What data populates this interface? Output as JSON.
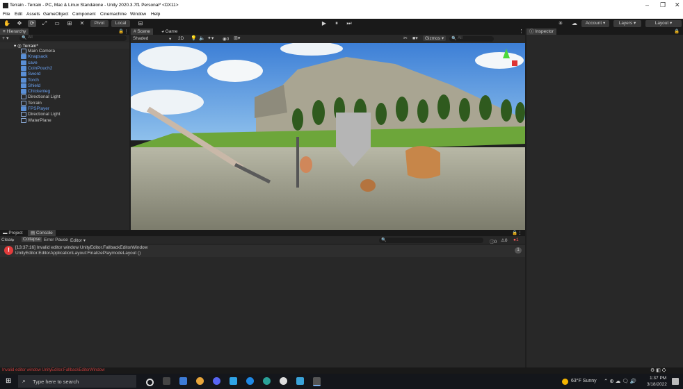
{
  "window": {
    "title": "Terrain - Terrain - PC, Mac & Linux Standalone - Unity 2020.3.7f1 Personal* <DX11>",
    "controls": [
      "–",
      "❐",
      "✕"
    ]
  },
  "menu": [
    "File",
    "Edit",
    "Assets",
    "GameObject",
    "Component",
    "Cinemachine",
    "Window",
    "Help"
  ],
  "toolbar": {
    "pivot_label": "Pivot",
    "local_label": "Local",
    "account_label": "Account ▾",
    "layers_label": "Layers ▾",
    "layout_label": "Layout ▾"
  },
  "hierarchy": {
    "tab_label": "Hierarchy",
    "search_placeholder": "All",
    "add_label": "+ ▾",
    "scene_label": "Terrain*",
    "items": [
      {
        "label": "Main Camera",
        "prefab": false
      },
      {
        "label": "Knapsack",
        "prefab": true
      },
      {
        "label": "cave",
        "prefab": true
      },
      {
        "label": "CoinPouch2",
        "prefab": true
      },
      {
        "label": "Sword",
        "prefab": true
      },
      {
        "label": "Torch",
        "prefab": true
      },
      {
        "label": "Shield",
        "prefab": true
      },
      {
        "label": "Chickenleg",
        "prefab": true
      },
      {
        "label": "Directional Light",
        "prefab": false
      },
      {
        "label": "Terrain",
        "prefab": false
      },
      {
        "label": "FPSPlayer",
        "prefab": true
      },
      {
        "label": "Directional Light",
        "prefab": false
      },
      {
        "label": "WaterPlane",
        "prefab": false
      }
    ]
  },
  "scene": {
    "tab_scene": "Scene",
    "tab_game": "Game",
    "shading": "Shaded",
    "mode_2d": "2D",
    "gizmos": "Gizmos ▾",
    "search_placeholder": "All",
    "counter": "0"
  },
  "inspector": {
    "tab_label": "Inspector"
  },
  "console": {
    "tab_project": "Project",
    "tab_console": "Console",
    "clear": "Clear",
    "collapse": "Collapse",
    "error_pause": "Error Pause",
    "editor": "Editor ▾",
    "counts": {
      "logs": "0",
      "warnings": "0",
      "errors": "1"
    },
    "entry_line1": "[13:37:16] Invalid editor window UnityEditor.FallbackEditorWindow",
    "entry_line2": "UnityEditor.EditorApplicationLayout:FinalizePlaymodeLayout ()",
    "entry_count": "1"
  },
  "status_message": "Invalid editor window UnityEditor.FallbackEditorWindow",
  "taskbar": {
    "search_placeholder": "Type here to search",
    "weather": "63°F  Sunny",
    "time": "1:37 PM",
    "date": "3/18/2022"
  }
}
